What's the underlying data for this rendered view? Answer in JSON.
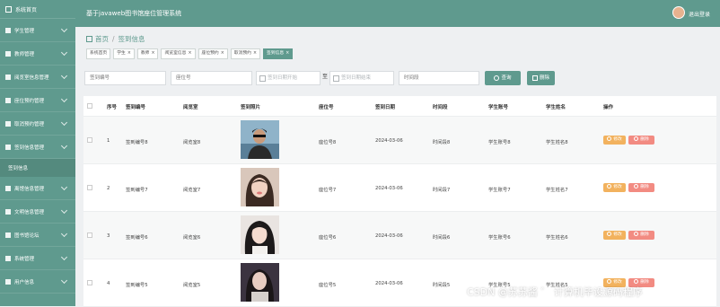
{
  "sidebar": {
    "brand": "系统首页",
    "items": [
      {
        "label": "学生管理"
      },
      {
        "label": "教师管理"
      },
      {
        "label": "阅览室信息管理"
      },
      {
        "label": "座位预约管理"
      },
      {
        "label": "取消预约管理"
      },
      {
        "label": "签到信息管理"
      },
      {
        "label": "签到信息"
      },
      {
        "label": "离馆信息管理"
      },
      {
        "label": "文明信息管理"
      },
      {
        "label": "图书馆论坛"
      },
      {
        "label": "系统管理"
      },
      {
        "label": "用户信息"
      }
    ]
  },
  "header": {
    "title": "基于javaweb图书馆座位管理系统",
    "logout": "退出登录"
  },
  "breadcrumb": {
    "home": "首页",
    "current": "签到信息"
  },
  "tabs": [
    {
      "label": "系统首页",
      "closable": false
    },
    {
      "label": "学生",
      "closable": true
    },
    {
      "label": "教师",
      "closable": true
    },
    {
      "label": "阅览室信息",
      "closable": true
    },
    {
      "label": "座位预约",
      "closable": true
    },
    {
      "label": "取消预约",
      "closable": true
    },
    {
      "label": "签到信息",
      "closable": true,
      "active": true
    }
  ],
  "search": {
    "sign_no": "签到编号",
    "seat_no": "座位号",
    "date_start": "签到日期开始",
    "to": "至",
    "date_end": "签到日期结束",
    "time_slot": "时间段",
    "search_btn": "查询",
    "delete_btn": "删除"
  },
  "table": {
    "headers": [
      "序号",
      "签到编号",
      "阅览室",
      "签到照片",
      "座位号",
      "签到日期",
      "时间段",
      "学生账号",
      "学生姓名",
      "操作"
    ],
    "rows": [
      {
        "index": "1",
        "sign_no": "签到编号8",
        "room": "阅览室8",
        "seat": "座位号8",
        "date": "2024-03-06",
        "slot": "时间段8",
        "account": "学生账号8",
        "name": "学生姓名8"
      },
      {
        "index": "2",
        "sign_no": "签到编号7",
        "room": "阅览室7",
        "seat": "座位号7",
        "date": "2024-03-06",
        "slot": "时间段7",
        "account": "学生账号7",
        "name": "学生姓名7"
      },
      {
        "index": "3",
        "sign_no": "签到编号6",
        "room": "阅览室6",
        "seat": "座位号6",
        "date": "2024-03-06",
        "slot": "时间段6",
        "account": "学生账号6",
        "name": "学生姓名6"
      },
      {
        "index": "4",
        "sign_no": "签到编号5",
        "room": "阅览室5",
        "seat": "座位号5",
        "date": "2024-03-06",
        "slot": "时间段5",
        "account": "学生账号5",
        "name": "学生姓名5"
      }
    ],
    "edit_label": "修改",
    "delete_label": "删除"
  },
  "watermark": "CSDN @苏苏酱 ゛ 计算机毕设源码程序",
  "colors": {
    "accent": "#5f9a8e",
    "edit": "#f2b25e",
    "delete": "#f28b82"
  }
}
